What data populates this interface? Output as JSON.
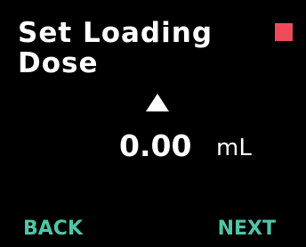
{
  "screen": {
    "title": "Set Loading Dose",
    "status_indicator_color": "#ef4a5c",
    "adjust_icon": "up-arrow-icon"
  },
  "dose": {
    "value": "0.00",
    "unit": "mL"
  },
  "softkeys": {
    "back_label": "BACK",
    "next_label": "NEXT",
    "color": "#4ec6a8"
  }
}
